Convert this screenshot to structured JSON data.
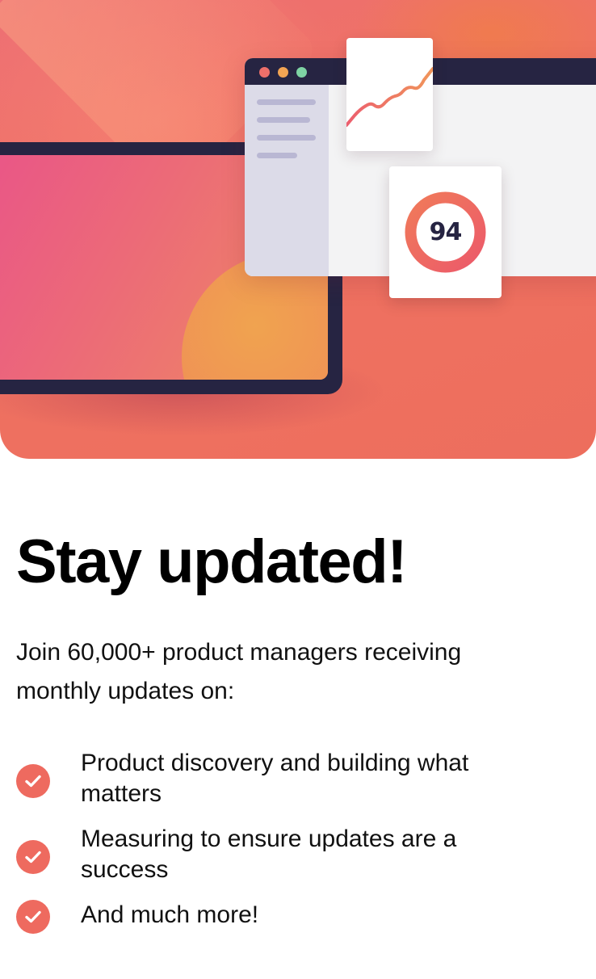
{
  "hero": {
    "score_value": "94",
    "colors": {
      "accent": "#ee6a5f",
      "dark": "#262442",
      "pink": "#e9528a",
      "orange": "#ef8a62"
    }
  },
  "newsletter": {
    "title": "Stay updated!",
    "intro": "Join 60,000+ product managers receiving monthly updates on:",
    "benefits": [
      {
        "icon": "check-circle-icon",
        "text": "Product discovery and building what matters"
      },
      {
        "icon": "check-circle-icon",
        "text": "Measuring to ensure updates are a success"
      },
      {
        "icon": "check-circle-icon",
        "text": "And much more!"
      }
    ]
  }
}
